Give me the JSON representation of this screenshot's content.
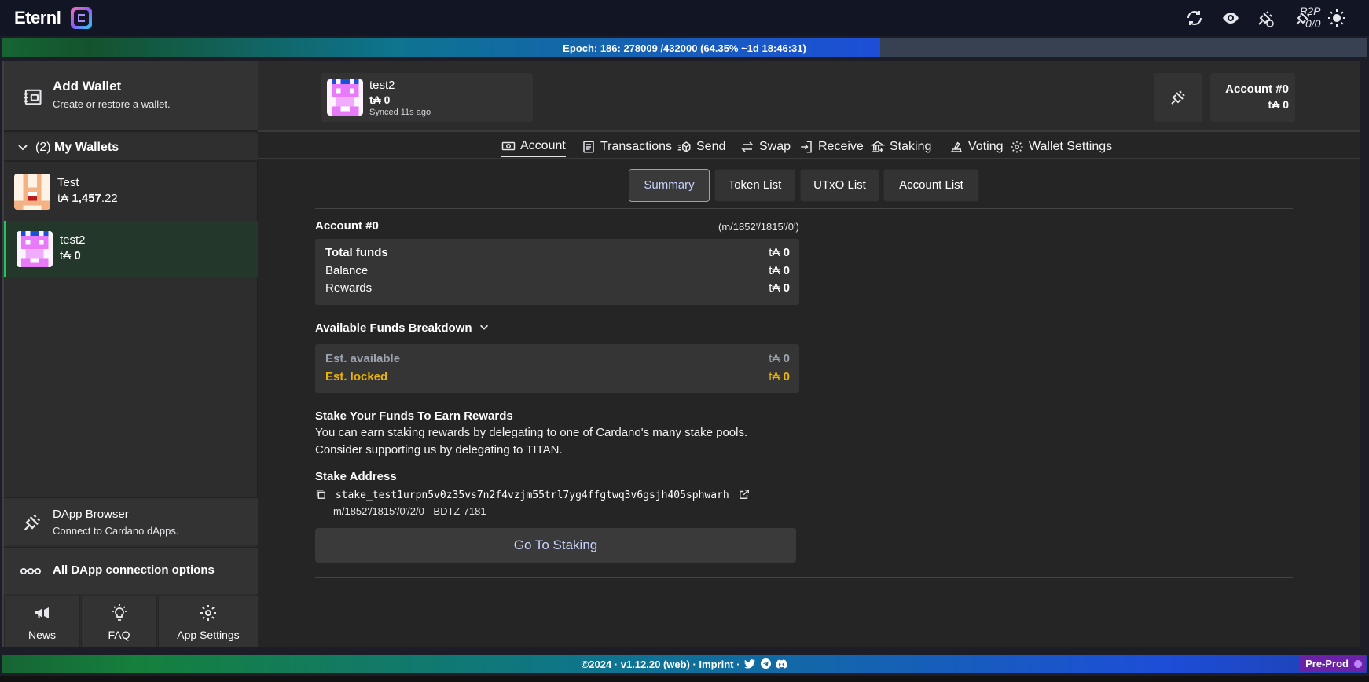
{
  "app": {
    "name": "Eternl",
    "p2p_label": "P2P",
    "p2p_count": "0/0"
  },
  "epoch": {
    "text_prefix": "Epoch: 186: 278009 /432000",
    "text_suffix": "(64.35%  ~1d 18:46:31)",
    "progress_percent": 64.35
  },
  "sidebar": {
    "add_wallet_title": "Add Wallet",
    "add_wallet_sub": "Create or restore a wallet.",
    "my_wallets_count": "(2)",
    "my_wallets_label": "My Wallets",
    "wallets": [
      {
        "name": "Test",
        "currency": "t₳",
        "balance_int": "1,457",
        "balance_dec": ".22"
      },
      {
        "name": "test2",
        "currency": "t₳",
        "balance_int": "0",
        "balance_dec": ""
      }
    ],
    "dapp_title": "DApp Browser",
    "dapp_sub": "Connect to Cardano dApps.",
    "all_dapp": "All DApp connection options",
    "bottom": {
      "news": "News",
      "faq": "FAQ",
      "settings": "App Settings"
    }
  },
  "header": {
    "wallet_name": "test2",
    "wallet_balance": "t₳ 0",
    "synced": "Synced 11s ago",
    "account_label": "Account #0",
    "account_balance": "t₳ 0"
  },
  "nav": {
    "account": "Account",
    "transactions": "Transactions",
    "send": "Send",
    "swap": "Swap",
    "receive": "Receive",
    "staking": "Staking",
    "voting": "Voting",
    "wallet_settings": "Wallet Settings"
  },
  "subtabs": {
    "summary": "Summary",
    "tokens": "Token List",
    "utxo": "UTxO List",
    "accounts": "Account List"
  },
  "summary": {
    "account_title": "Account #0",
    "account_path": "(m/1852'/1815'/0')",
    "total_funds": "Total funds",
    "balance": "Balance",
    "rewards": "Rewards",
    "currency": "t₳",
    "total_value": "0",
    "balance_value": "0",
    "rewards_value": "0",
    "breakdown_title": "Available Funds Breakdown",
    "est_available": "Est. available",
    "est_available_value": "0",
    "est_locked": "Est. locked",
    "est_locked_value": "0",
    "stake_title": "Stake Your Funds To Earn Rewards",
    "stake_line1": "You can earn staking rewards by delegating to one of Cardano's many stake pools.",
    "stake_line2": "Consider supporting us by delegating to TITAN.",
    "stake_address_title": "Stake Address",
    "stake_address": "stake_test1urpn5v0z35vs7n2f4vzjm55trl7yg4ffgtwq3v6gsjh405sphwarh",
    "stake_path": "m/1852'/1815'/0'/2/0 - BDTZ-7181",
    "go_staking": "Go To Staking"
  },
  "footer": {
    "text": "©2024 · v1.12.20 (web) · Imprint ·",
    "network": "Pre-Prod"
  }
}
